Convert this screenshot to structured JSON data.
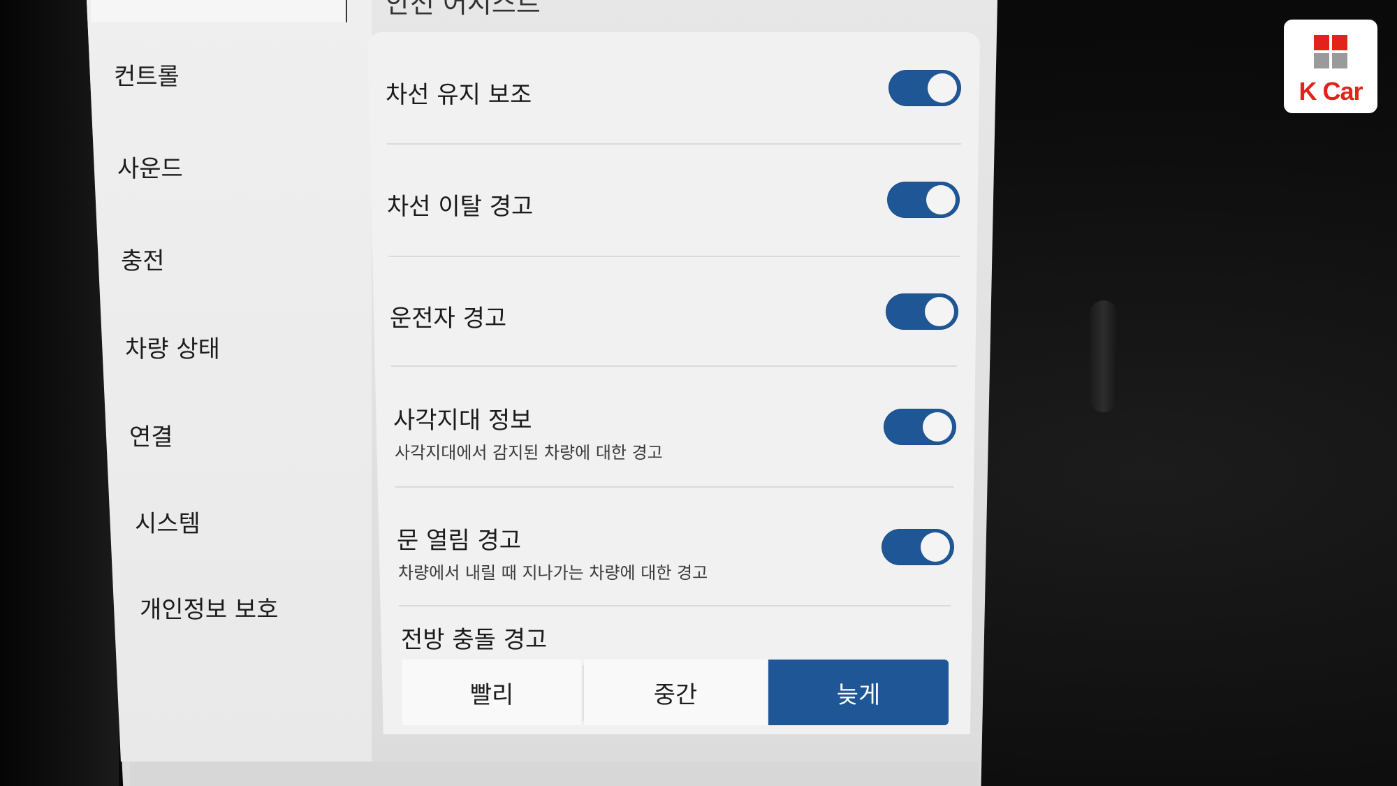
{
  "page_title": "안전 어시스트",
  "sidebar": {
    "items": [
      {
        "label": "컨트롤"
      },
      {
        "label": "사운드"
      },
      {
        "label": "충전"
      },
      {
        "label": "차량 상태"
      },
      {
        "label": "연결"
      },
      {
        "label": "시스템"
      },
      {
        "label": "개인정보 보호"
      }
    ]
  },
  "settings": [
    {
      "title": "차선 유지 보조",
      "description": "",
      "enabled": true
    },
    {
      "title": "차선 이탈 경고",
      "description": "",
      "enabled": true
    },
    {
      "title": "운전자 경고",
      "description": "",
      "enabled": true
    },
    {
      "title": "사각지대 정보",
      "description": "사각지대에서 감지된 차량에 대한 경고",
      "enabled": true
    },
    {
      "title": "문 열림 경고",
      "description": "차량에서 내릴 때 지나가는 차량에 대한 경고",
      "enabled": true
    }
  ],
  "collision": {
    "title": "전방 충돌 경고",
    "options": [
      "빨리",
      "중간",
      "늦게"
    ],
    "selected": "늦게"
  },
  "logo": {
    "text": "K Car",
    "color": "#e2231a"
  },
  "colors": {
    "accent": "#1f5695",
    "panel": "#f1f1f1"
  }
}
